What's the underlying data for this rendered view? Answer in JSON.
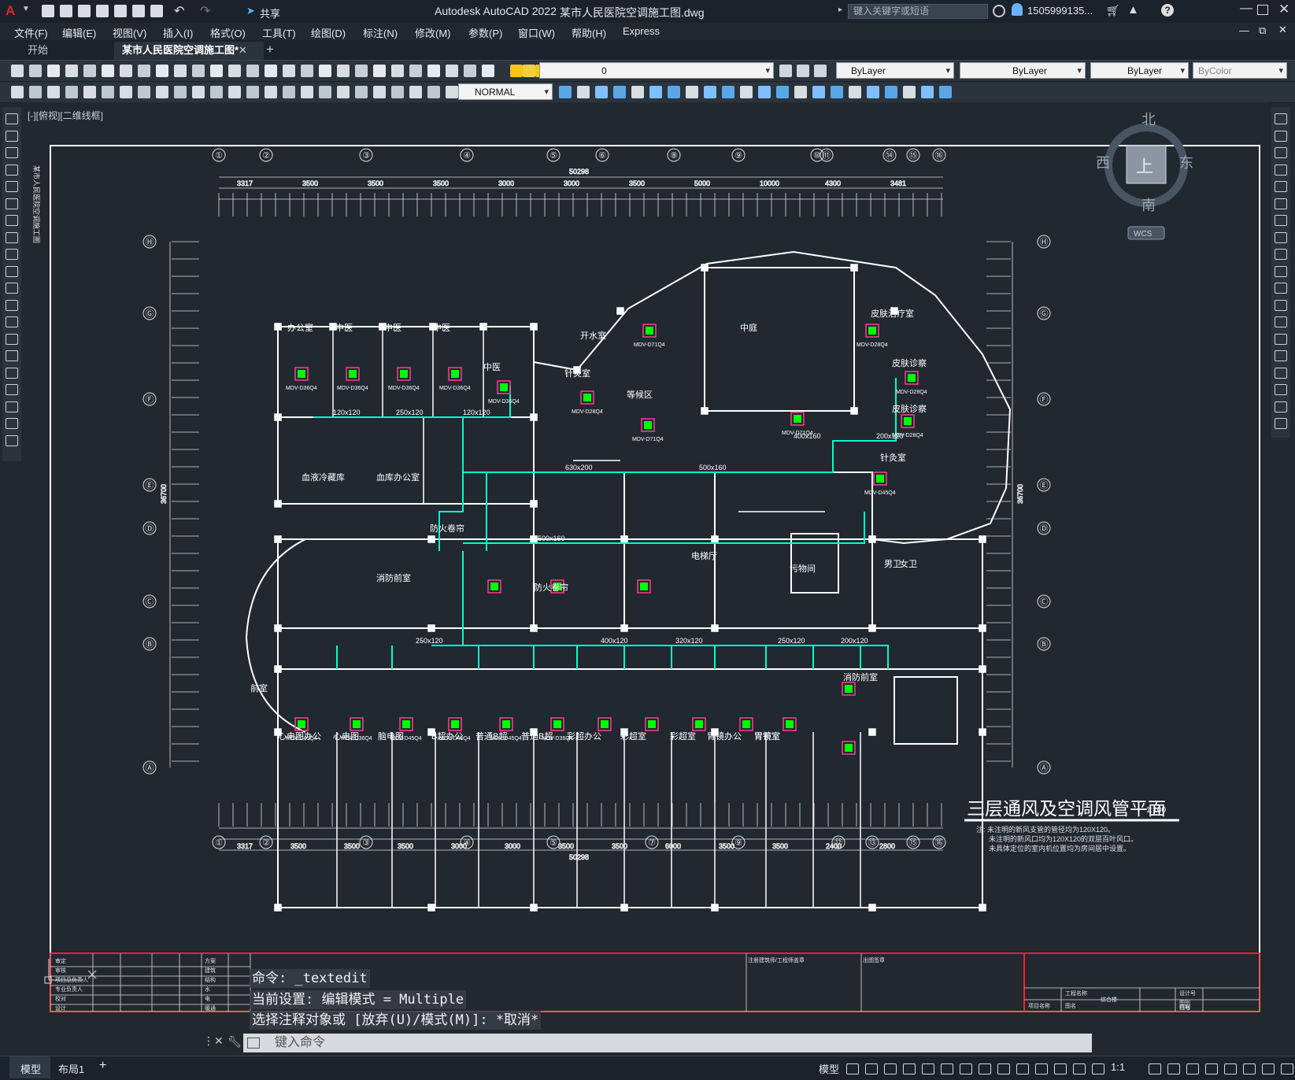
{
  "titlebar": {
    "app": "Autodesk AutoCAD 2022",
    "file": "某市人民医院空调施工图.dwg",
    "share": "共享",
    "search_placeholder": "键入关键字或短语",
    "user": "1505999135..."
  },
  "menu": [
    "文件(F)",
    "编辑(E)",
    "视图(V)",
    "插入(I)",
    "格式(O)",
    "工具(T)",
    "绘图(D)",
    "标注(N)",
    "修改(M)",
    "参数(P)",
    "窗口(W)",
    "帮助(H)",
    "Express"
  ],
  "tabs": {
    "start": "开始",
    "doc": "某市人民医院空调施工图*"
  },
  "properties": {
    "layer": "0",
    "color": "ByLayer",
    "linetype": "ByLayer",
    "lineweight": "ByLayer",
    "plotstyle": "ByColor",
    "textstyle": "NORMAL"
  },
  "viewport": {
    "label": "[-][俯视][二维线框]",
    "compass": {
      "n": "北",
      "s": "南",
      "w": "西",
      "e": "东",
      "top": "上",
      "wcs": "WCS"
    }
  },
  "drawing": {
    "title": "三层通风及空调风管平面",
    "scale": "1:100",
    "notes": [
      "注: 未注明的新风支管的管径均为120X120。",
      "未注明的新风口均为120X120的双层百叶风口。",
      "未具体定位的室内机位置均为房间居中设置。"
    ],
    "side_text": "某市人民医院空调施工图",
    "axes_top": [
      "①",
      "②",
      "③",
      "④",
      "⑤",
      "⑥",
      "⑧",
      "⑨",
      "⑩",
      "⑪",
      "⑭",
      "⑮",
      "⑯"
    ],
    "axes_bottom": [
      "①",
      "②",
      "③",
      "④",
      "⑤",
      "⑦",
      "⑨",
      "⑫",
      "⑬",
      "⑮",
      "⑯"
    ],
    "axes_side": [
      "Ⓗ",
      "Ⓖ",
      "Ⓕ",
      "Ⓔ",
      "Ⓓ",
      "Ⓒ",
      "Ⓑ",
      "Ⓐ"
    ],
    "dim_total": "50298",
    "dim_side": "36700",
    "dims_top": [
      "3317",
      "3500",
      "3500",
      "3500",
      "3000",
      "3000",
      "3500",
      "5000",
      "10000",
      "4300",
      "3481"
    ],
    "dims_bottom": [
      "3317",
      "3500",
      "3500",
      "3500",
      "3000",
      "3000",
      "3500",
      "3500",
      "6000",
      "3500",
      "3500",
      "2400",
      "2800"
    ],
    "rooms_top": [
      "办公室",
      "中医",
      "中医",
      "中医",
      "中医",
      "开水室",
      "针灸室",
      "等候区",
      "中庭",
      "皮肤治疗室",
      "皮肤诊察",
      "皮肤诊察",
      "针灸室"
    ],
    "rooms_mid": [
      "血液冷藏库",
      "血库办公室",
      "防火卷帘",
      "消防前室",
      "防火卷帘",
      "电梯厅",
      "污物间",
      "男卫",
      "女卫",
      "前室"
    ],
    "rooms_bottom": [
      "心电图办公",
      "心电图",
      "脑电图",
      "B超办公",
      "普通B超",
      "普通B超",
      "彩超办公",
      "彩超室",
      "彩超室",
      "胃镜办公",
      "胃镜室",
      "胃镜室",
      "消防前室"
    ],
    "duct_labels": [
      "120x120",
      "250x120",
      "120x120",
      "630x200",
      "500x160",
      "400x160",
      "200x120",
      "250x120",
      "500x160",
      "320x120",
      "250x120",
      "200x120",
      "400x120"
    ],
    "units": [
      "MDV-D36Q4",
      "MDV-D36Q4",
      "MDV-D36Q4",
      "MDV-D36Q4",
      "MDV-D36Q4",
      "MDV-D71Q4",
      "MDV-D28Q4",
      "MDV-D71Q4",
      "MDV-D71Q4",
      "MDV-D28Q4",
      "MDV-D28Q4",
      "MDV-D28Q4",
      "MDV-D45Q4",
      "MDV-D45Q4",
      "MDV-D36Q4",
      "MDV-D45Q4",
      "MDV-D45Q4",
      "MDV-D45Q4",
      "MDV-D36Q4"
    ],
    "titleblock": {
      "left": [
        "审定",
        "审核",
        "项目总负责人",
        "专业负责人",
        "校对",
        "设计"
      ],
      "center": [
        "方案",
        "建筑",
        "结构",
        "水",
        "电",
        "暖通"
      ],
      "mid": [
        "注册建筑师/工程师盖章",
        "出图签章"
      ],
      "right": [
        "工程名称",
        "综合楼",
        "设计号",
        "图别",
        "图号",
        "日期",
        "项目名称",
        "图名"
      ]
    }
  },
  "command": {
    "line1": "命令: _textedit",
    "line2": "当前设置: 编辑模式 = Multiple",
    "line3": "选择注释对象或 [放弃(U)/模式(M)]: *取消*",
    "input_placeholder": "键入命令"
  },
  "status": {
    "model_tab": "模型",
    "layout_tab": "布局1",
    "model": "模型",
    "scale": "1:1"
  },
  "colors": {
    "accent": "#0696d7",
    "duct": "#00ffcc",
    "unit": "#00ff00",
    "red": "#ff0000",
    "bg": "#212830"
  }
}
